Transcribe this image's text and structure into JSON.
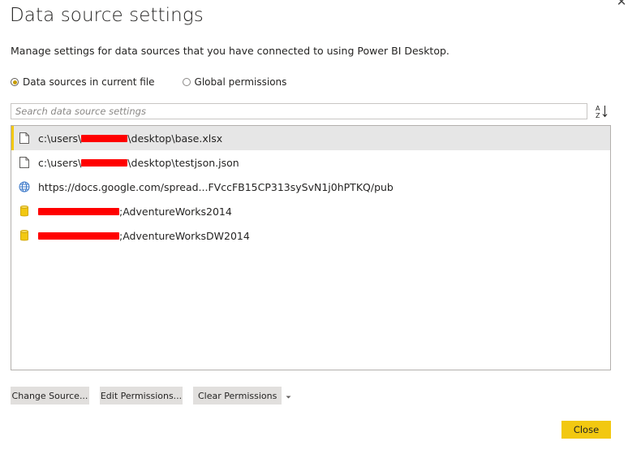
{
  "dialog": {
    "title": "Data source settings",
    "subtitle": "Manage settings for data sources that you have connected to using Power BI Desktop.",
    "close_icon": "close-icon"
  },
  "scope": {
    "options": [
      {
        "label": "Data sources in current file",
        "checked": true
      },
      {
        "label": "Global permissions",
        "checked": false
      }
    ]
  },
  "search": {
    "placeholder": "Search data source settings",
    "value": ""
  },
  "sort": {
    "icon": "sort-az-icon"
  },
  "sources": [
    {
      "icon": "file-icon",
      "prefix": "c:\\users\\",
      "suffix": "\\desktop\\base.xlsx",
      "selected": true
    },
    {
      "icon": "file-icon",
      "prefix": "c:\\users\\",
      "suffix": "\\desktop\\testjson.json",
      "selected": false
    },
    {
      "icon": "globe-icon",
      "prefix": "https://docs.google.com/spread...FVccFB15CP313sySvN1j0hPTKQ/pub",
      "suffix": "",
      "selected": false
    },
    {
      "icon": "database-icon",
      "prefix": "",
      "suffix": ";AdventureWorks2014",
      "selected": false
    },
    {
      "icon": "database-icon",
      "prefix": "",
      "suffix": ";AdventureWorksDW2014",
      "selected": false
    }
  ],
  "buttons": {
    "change_source": "Change Source...",
    "edit_permissions": "Edit Permissions...",
    "clear_permissions": "Clear Permissions",
    "close": "Close"
  },
  "colors": {
    "accent": "#f2c811",
    "selected_row": "#e6e6e6",
    "redaction": "#ff0000"
  }
}
